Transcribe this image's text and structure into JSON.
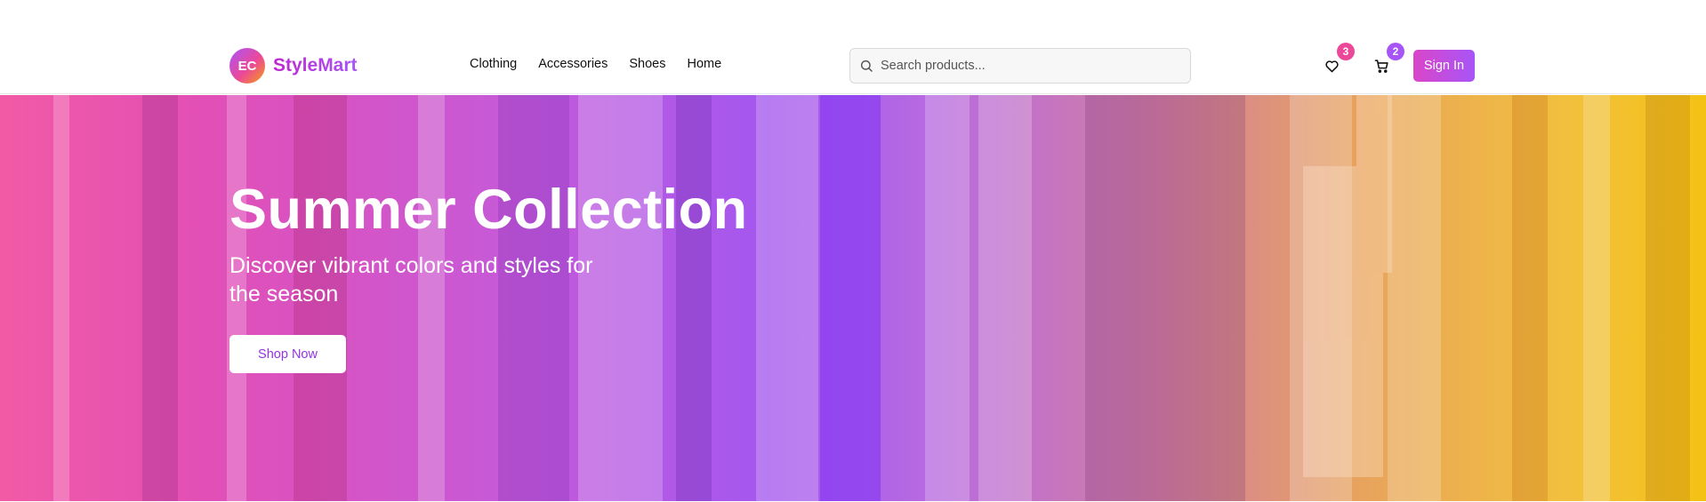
{
  "header": {
    "logo_initials": "EC",
    "brand_name": "StyleMart",
    "nav": [
      {
        "label": "Clothing"
      },
      {
        "label": "Accessories"
      },
      {
        "label": "Shoes"
      },
      {
        "label": "Home"
      }
    ],
    "search": {
      "placeholder": "Search products...",
      "value": "",
      "icon": "search-icon"
    },
    "wishlist": {
      "icon": "heart-icon",
      "count": "3",
      "badge_color": "#ec4899"
    },
    "cart": {
      "icon": "cart-icon",
      "count": "2",
      "badge_color": "#a855f7"
    },
    "sign_in_label": "Sign In"
  },
  "hero": {
    "title": "Summer Collection",
    "subtitle": "Discover vibrant colors and styles for the season",
    "cta_label": "Shop Now"
  },
  "colors": {
    "accent_pink": "#ec4899",
    "accent_purple": "#a855f7",
    "accent_yellow": "#f4c213"
  }
}
